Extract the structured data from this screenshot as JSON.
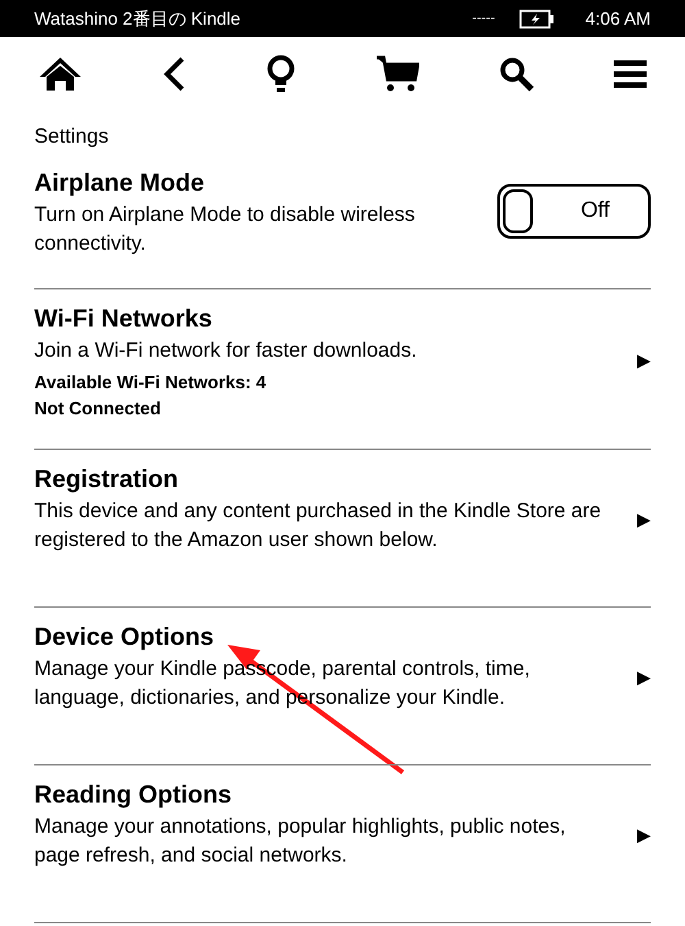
{
  "status_bar": {
    "device_name": "Watashino 2番目の Kindle",
    "signal": "-----",
    "time": "4:06 AM"
  },
  "page_title": "Settings",
  "settings": [
    {
      "kind": "toggle",
      "title": "Airplane Mode",
      "description": "Turn on Airplane Mode to disable wireless connectivity.",
      "toggle": {
        "label": "Off",
        "on": false
      }
    },
    {
      "kind": "link",
      "title": "Wi-Fi Networks",
      "description": "Join a Wi-Fi network for faster downloads.",
      "details": [
        "Available Wi-Fi Networks: 4",
        "Not Connected"
      ],
      "arrow": "▶"
    },
    {
      "kind": "link",
      "title": "Registration",
      "description": "This device and any content purchased in the Kindle Store are registered to the Amazon user shown below.",
      "arrow": "▶"
    },
    {
      "kind": "link",
      "title": "Device Options",
      "description": "Manage your Kindle passcode, parental controls, time, language, dictionaries, and personalize your Kindle.",
      "arrow": "▶"
    },
    {
      "kind": "link",
      "title": "Reading Options",
      "description": "Manage your annotations, popular highlights, public notes, page refresh, and social networks.",
      "arrow": "▶"
    }
  ]
}
